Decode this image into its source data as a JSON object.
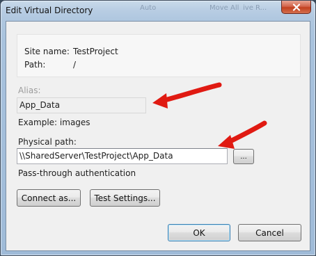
{
  "window": {
    "title": "Edit Virtual Directory"
  },
  "background_ghost": [
    "Auto",
    "Move All",
    "ive R..."
  ],
  "info": {
    "site_name_label": "Site name:",
    "site_name_value": "TestProject",
    "path_label": "Path:",
    "path_value": "/"
  },
  "alias": {
    "label": "Alias:",
    "value": "App_Data",
    "example": "Example: images"
  },
  "physical_path": {
    "label": "Physical path:",
    "value": "\\\\SharedServer\\TestProject\\App_Data",
    "browse_label": "..."
  },
  "pass_through": "Pass-through authentication",
  "buttons": {
    "connect_as": "Connect as...",
    "test_settings": "Test Settings...",
    "ok": "OK",
    "cancel": "Cancel"
  },
  "colors": {
    "annotation_arrow": "#e01a12",
    "close_button": "#c2401f"
  }
}
